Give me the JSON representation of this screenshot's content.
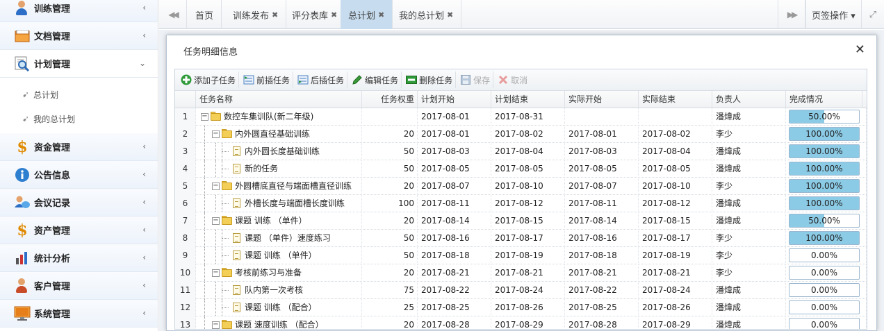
{
  "sidebar": {
    "items": [
      {
        "label": "训练管理",
        "icon": "trainer-icon"
      },
      {
        "label": "文档管理",
        "icon": "folder-icon"
      },
      {
        "label": "计划管理",
        "icon": "magnifier-icon"
      },
      {
        "label": "资金管理",
        "icon": "dollar-icon"
      },
      {
        "label": "公告信息",
        "icon": "info-icon"
      },
      {
        "label": "会议记录",
        "icon": "users-icon"
      },
      {
        "label": "资产管理",
        "icon": "dollar-icon"
      },
      {
        "label": "统计分析",
        "icon": "chart-icon"
      },
      {
        "label": "客户管理",
        "icon": "customer-icon"
      },
      {
        "label": "系统管理",
        "icon": "monitor-icon"
      }
    ],
    "subitems": [
      {
        "label": "总计划"
      },
      {
        "label": "我的总计划"
      }
    ],
    "collapsed_arrow": "‹",
    "expanded_arrow": "⌄"
  },
  "tabs": {
    "prev": "◀◀",
    "next": "▶▶",
    "items": [
      {
        "label": "首页",
        "closable": false
      },
      {
        "label": "训练发布",
        "closable": true
      },
      {
        "label": "评分表库",
        "closable": true
      },
      {
        "label": "总计划",
        "closable": true,
        "active": true
      },
      {
        "label": "我的总计划",
        "closable": true
      }
    ],
    "close_glyph": "✖",
    "page_ops": "页签操作 ▾",
    "fullscreen": "⤢"
  },
  "dialog": {
    "title": "任务明细信息",
    "close": "✕"
  },
  "toolbar": {
    "add_child": "添加子任务",
    "insert_before": "前插任务",
    "insert_after": "后插任务",
    "edit": "编辑任务",
    "delete": "删除任务",
    "save": "保存",
    "cancel": "取消"
  },
  "table": {
    "columns": [
      "任务名称",
      "任务权重",
      "计划开始",
      "计划结束",
      "实际开始",
      "实际结束",
      "负责人",
      "完成情况"
    ],
    "rows": [
      {
        "n": "1",
        "level": 0,
        "type": "folder",
        "name": "数控车集训队(新二年级)",
        "weight": "",
        "ps": "2017-08-01",
        "pe": "2017-08-31",
        "as": "",
        "ae": "",
        "owner": "潘煒成",
        "progress": 50,
        "ptext": "50.00%"
      },
      {
        "n": "2",
        "level": 1,
        "type": "folder",
        "name": "内外圆直径基础训练",
        "weight": "20",
        "ps": "2017-08-01",
        "pe": "2017-08-02",
        "as": "2017-08-01",
        "ae": "2017-08-02",
        "owner": "李少",
        "progress": 100,
        "ptext": "100.00%"
      },
      {
        "n": "3",
        "level": 2,
        "type": "doc",
        "name": "内外圆长度基础训练",
        "weight": "50",
        "ps": "2017-08-03",
        "pe": "2017-08-04",
        "as": "2017-08-03",
        "ae": "2017-08-04",
        "owner": "潘煒成",
        "progress": 100,
        "ptext": "100.00%"
      },
      {
        "n": "4",
        "level": 2,
        "type": "doc",
        "name": "新的任务",
        "weight": "50",
        "ps": "2017-08-05",
        "pe": "2017-08-05",
        "as": "2017-08-05",
        "ae": "2017-08-05",
        "owner": "潘煒成",
        "progress": 100,
        "ptext": "100.00%"
      },
      {
        "n": "5",
        "level": 1,
        "type": "folder",
        "name": "外圆槽底直径与端面槽直径训练",
        "weight": "20",
        "ps": "2017-08-07",
        "pe": "2017-08-10",
        "as": "2017-08-07",
        "ae": "2017-08-10",
        "owner": "李少",
        "progress": 100,
        "ptext": "100.00%"
      },
      {
        "n": "6",
        "level": 2,
        "type": "doc",
        "name": "外槽长度与端面槽长度训练",
        "weight": "100",
        "ps": "2017-08-11",
        "pe": "2017-08-12",
        "as": "2017-08-11",
        "ae": "2017-08-12",
        "owner": "潘煒成",
        "progress": 100,
        "ptext": "100.00%"
      },
      {
        "n": "7",
        "level": 1,
        "type": "folder",
        "name": "课题 训练 （单件）",
        "weight": "20",
        "ps": "2017-08-14",
        "pe": "2017-08-15",
        "as": "2017-08-14",
        "ae": "2017-08-15",
        "owner": "潘煒成",
        "progress": 50,
        "ptext": "50.00%"
      },
      {
        "n": "8",
        "level": 2,
        "type": "doc",
        "name": "课题 （单件）速度练习",
        "weight": "50",
        "ps": "2017-08-16",
        "pe": "2017-08-17",
        "as": "2017-08-16",
        "ae": "2017-08-17",
        "owner": "李少",
        "progress": 100,
        "ptext": "100.00%"
      },
      {
        "n": "9",
        "level": 2,
        "type": "doc",
        "name": "课题 训练 （单件）",
        "weight": "50",
        "ps": "2017-08-18",
        "pe": "2017-08-19",
        "as": "2017-08-18",
        "ae": "2017-08-19",
        "owner": "李少",
        "progress": 0,
        "ptext": "0.00%"
      },
      {
        "n": "10",
        "level": 1,
        "type": "folder",
        "name": "考核前练习与准备",
        "weight": "20",
        "ps": "2017-08-21",
        "pe": "2017-08-21",
        "as": "2017-08-21",
        "ae": "2017-08-21",
        "owner": "李少",
        "progress": 0,
        "ptext": "0.00%"
      },
      {
        "n": "11",
        "level": 2,
        "type": "doc",
        "name": "队内第一次考核",
        "weight": "75",
        "ps": "2017-08-22",
        "pe": "2017-08-24",
        "as": "2017-08-22",
        "ae": "2017-08-24",
        "owner": "潘煒成",
        "progress": 0,
        "ptext": "0.00%"
      },
      {
        "n": "12",
        "level": 2,
        "type": "doc",
        "name": "课题 训练 （配合）",
        "weight": "25",
        "ps": "2017-08-25",
        "pe": "2017-08-26",
        "as": "2017-08-25",
        "ae": "2017-08-26",
        "owner": "潘煒成",
        "progress": 0,
        "ptext": "0.00%"
      },
      {
        "n": "13",
        "level": 1,
        "type": "folder",
        "name": "课题 速度训练 （配合）",
        "weight": "20",
        "ps": "2017-08-28",
        "pe": "2017-08-29",
        "as": "2017-08-28",
        "ae": "2017-08-29",
        "owner": "潘煒成",
        "progress": 0,
        "ptext": "0.00%"
      }
    ]
  },
  "colors": {
    "active_tab": "#c7ddef",
    "progress_fill": "#8ccbe6"
  }
}
